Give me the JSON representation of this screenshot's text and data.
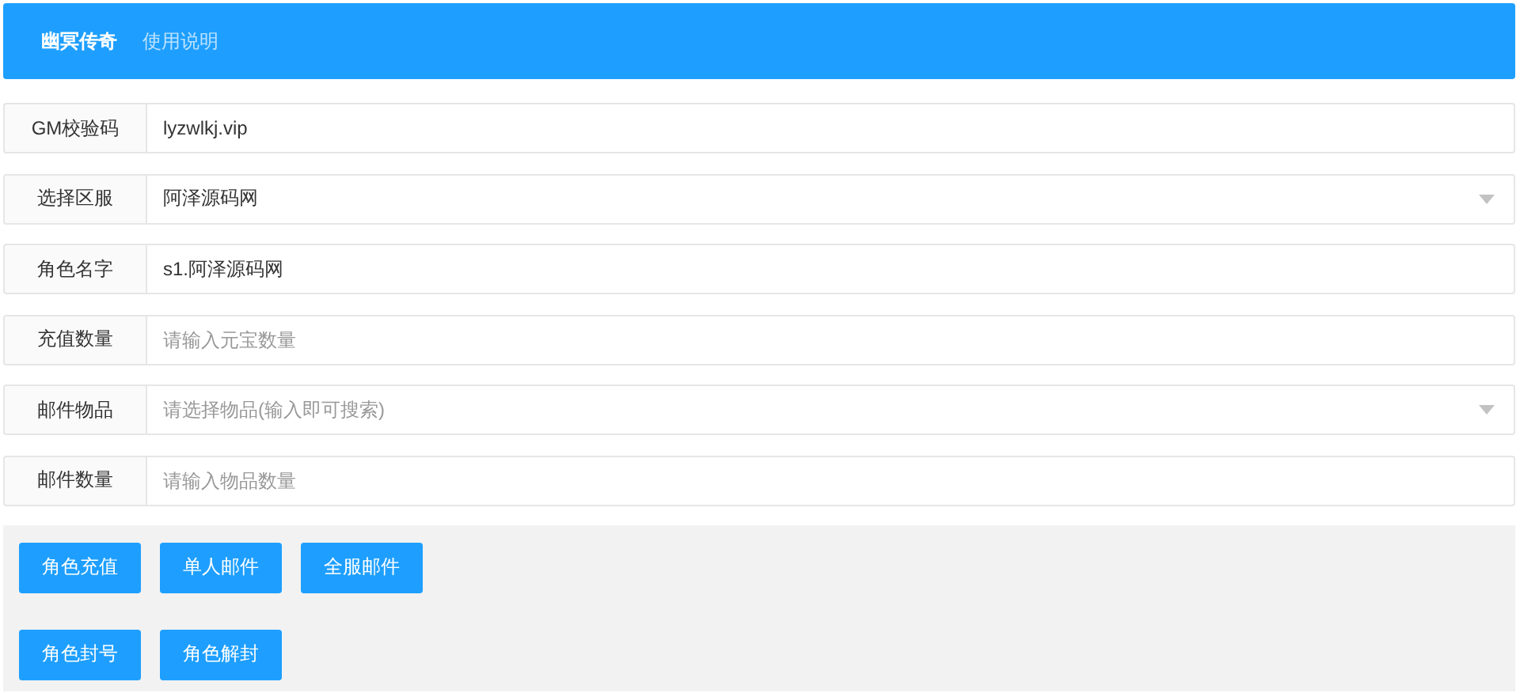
{
  "header": {
    "nav": [
      {
        "label": "幽冥传奇",
        "selected": true
      },
      {
        "label": "使用说明",
        "selected": false
      }
    ]
  },
  "fields": [
    {
      "label": "GM校验码",
      "kind": "input",
      "value": "lyzwlkj.vip"
    },
    {
      "label": "选择区服",
      "kind": "select",
      "value": "阿泽源码网"
    },
    {
      "label": "角色名字",
      "kind": "input",
      "value": "s1.阿泽源码网"
    },
    {
      "label": "充值数量",
      "kind": "input",
      "placeholder": "请输入元宝数量"
    },
    {
      "label": "邮件物品",
      "kind": "select",
      "placeholder": "请选择物品(输入即可搜索)"
    },
    {
      "label": "邮件数量",
      "kind": "input",
      "placeholder": "请输入物品数量"
    }
  ],
  "button_rows": [
    [
      "角色充值",
      "单人邮件",
      "全服邮件"
    ],
    [
      "角色封号",
      "角色解封"
    ]
  ]
}
